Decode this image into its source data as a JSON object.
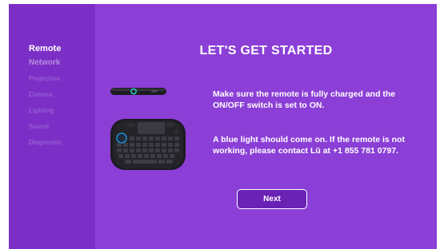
{
  "sidebar": {
    "items": [
      {
        "label": "Remote"
      },
      {
        "label": "Network"
      },
      {
        "label": "Projection"
      },
      {
        "label": "Camera"
      },
      {
        "label": "Lighting"
      },
      {
        "label": "Sound"
      },
      {
        "label": "Diagnostic"
      }
    ]
  },
  "main": {
    "title": "LET'S GET STARTED",
    "paragraph1": "Make sure the remote is fully charged and the ON/OFF switch is set to ON.",
    "paragraph2": "A blue light should come on. If the remote is not working, please contact Lū at  +1  855 781 0797.",
    "next_label": "Next"
  },
  "icons": {
    "remote_side": "remote-side-icon",
    "keyboard": "keyboard-remote-icon"
  },
  "colors": {
    "sidebar_bg": "#7c2fc6",
    "main_bg": "#8b3fd6",
    "button_bg": "#6a22b4",
    "text": "#ffffff",
    "power_light": "#1fa0e0"
  }
}
